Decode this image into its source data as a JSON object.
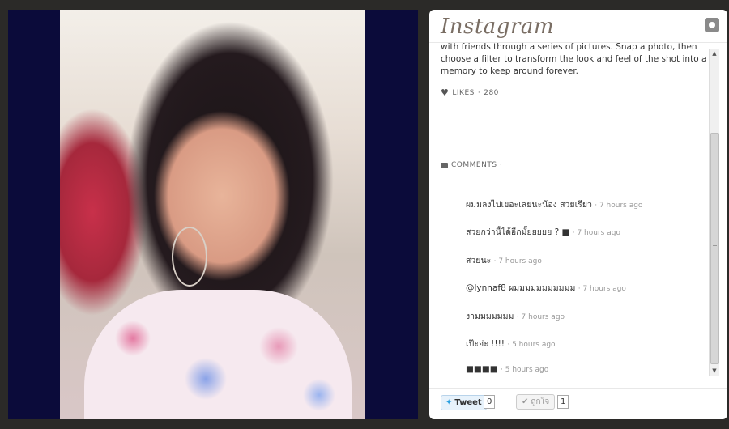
{
  "app": {
    "logo": "Instagram",
    "camera_icon": "camera-icon"
  },
  "post": {
    "description": "with friends through a series of pictures. Snap a photo, then choose a filter to transform the look and feel of the shot into a memory to keep around forever.",
    "likes_label": "LIKES",
    "likes_sep": "·",
    "likes_count": "280",
    "comments_label": "COMMENTS ·"
  },
  "comments": [
    {
      "text": "ผมมลงไปเยอะเลยนะน้อง สวยเรียว",
      "time": "· 7 hours ago"
    },
    {
      "text": "สวยกว่านี้ได้อีกมั้ยยยยย ? ■",
      "time": "· 7 hours ago"
    },
    {
      "text": "สวยนะ",
      "time": "· 7 hours ago"
    },
    {
      "text": "@lynnaf8 ผมมมมมมมมมมม",
      "time": "· 7 hours ago"
    },
    {
      "text": "งามมมมมมม",
      "time": "· 7 hours ago"
    },
    {
      "text": "เป๊ะอ่ะ !!!!",
      "time": "· 5 hours ago"
    },
    {
      "text": "■■■■",
      "time": "· 5 hours ago"
    }
  ],
  "footer": {
    "tweet_label": "Tweet",
    "tweet_count": "0",
    "like_label": "ถูกใจ",
    "like_count": "1"
  },
  "icons": {
    "heart": "heart-icon",
    "comments": "speech-bubble-icon",
    "tweet": "twitter-bird-icon",
    "like": "checkmark-icon"
  }
}
